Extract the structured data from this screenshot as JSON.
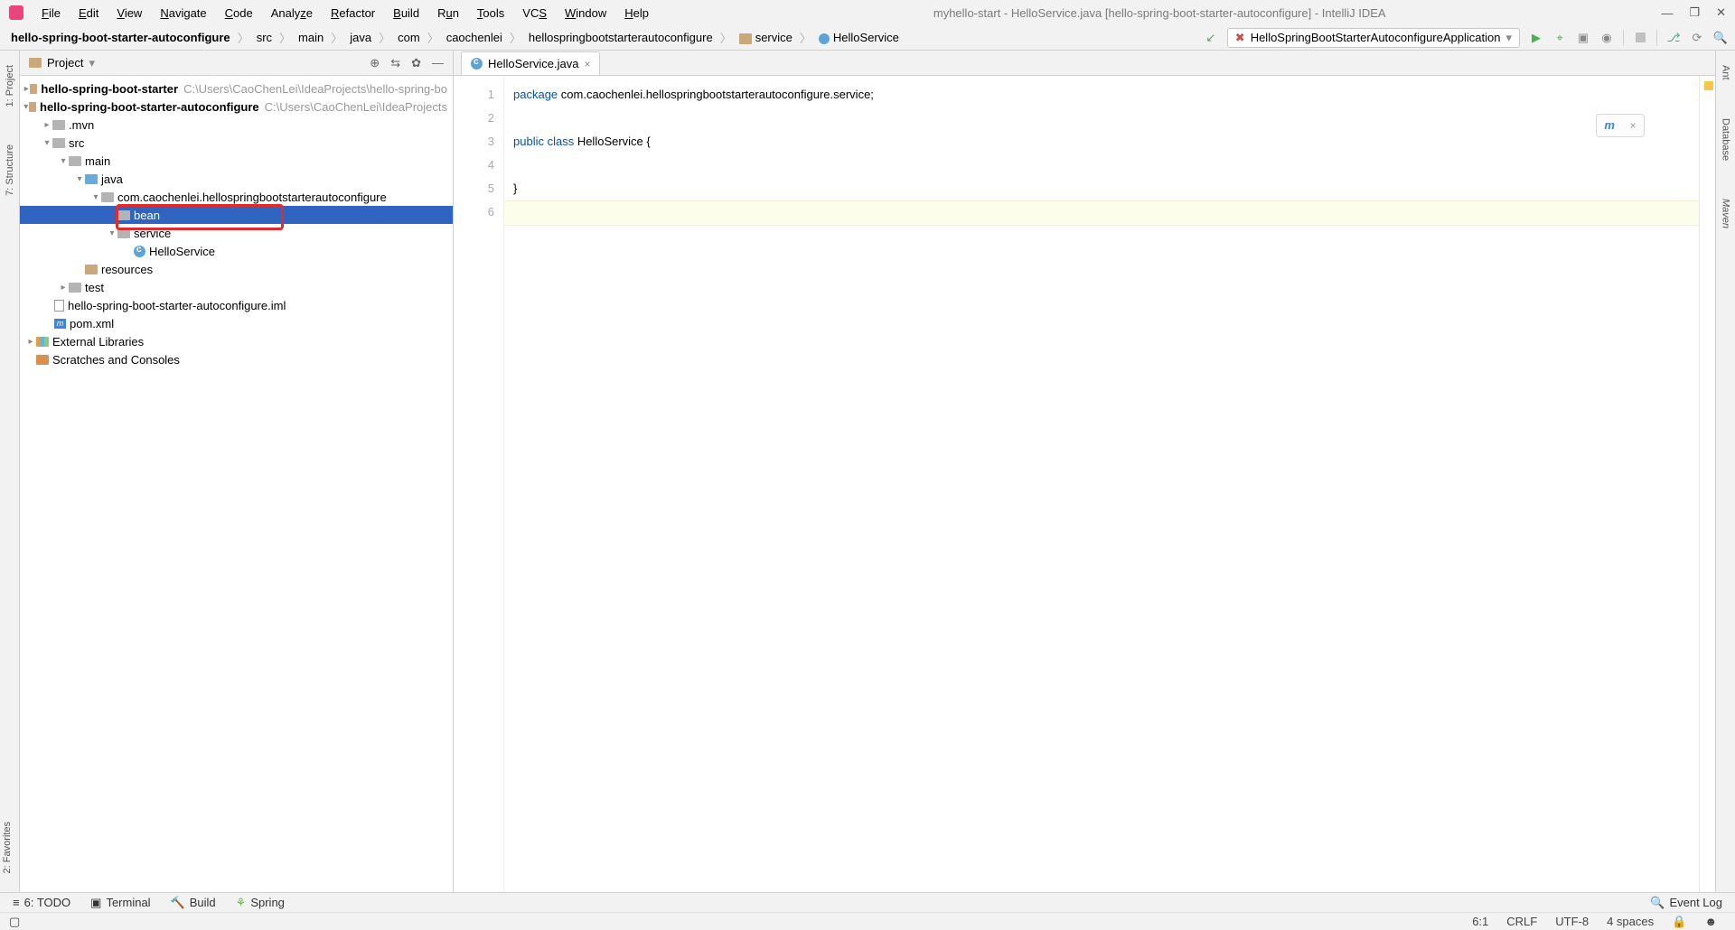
{
  "title": "myhello-start - HelloService.java [hello-spring-boot-starter-autoconfigure] - IntelliJ IDEA",
  "menu": [
    "File",
    "Edit",
    "View",
    "Navigate",
    "Code",
    "Analyze",
    "Refactor",
    "Build",
    "Run",
    "Tools",
    "VCS",
    "Window",
    "Help"
  ],
  "breadcrumbs": [
    "hello-spring-boot-starter-autoconfigure",
    "src",
    "main",
    "java",
    "com",
    "caochenlei",
    "hellospringbootstarterautoconfigure",
    "service",
    "HelloService"
  ],
  "run_config": "HelloSpringBootStarterAutoconfigureApplication",
  "project_panel_title": "Project",
  "left_tabs": [
    "1: Project",
    "7: Structure"
  ],
  "left_bottom_tab": "2: Favorites",
  "right_tabs": [
    "Ant",
    "Database",
    "Maven"
  ],
  "tree": {
    "module1": {
      "name": "hello-spring-boot-starter",
      "path": "C:\\Users\\CaoChenLei\\IdeaProjects\\hello-spring-bo"
    },
    "module2": {
      "name": "hello-spring-boot-starter-autoconfigure",
      "path": "C:\\Users\\CaoChenLei\\IdeaProjects"
    },
    "mvn": ".mvn",
    "src": "src",
    "main": "main",
    "java": "java",
    "pkg": "com.caochenlei.hellospringbootstarterautoconfigure",
    "bean": "bean",
    "service": "service",
    "helloservice": "HelloService",
    "resources": "resources",
    "test": "test",
    "iml": "hello-spring-boot-starter-autoconfigure.iml",
    "pom": "pom.xml",
    "ext": "External Libraries",
    "scratch": "Scratches and Consoles"
  },
  "editor_tab": "HelloService.java",
  "code": {
    "l1a": "package",
    "l1b": " com.caochenlei.hellospringbootstarterautoconfigure.service;",
    "l3a": "public",
    "l3b": " class",
    "l3c": " HelloService {",
    "l5": "}",
    "line_numbers": [
      "1",
      "2",
      "3",
      "4",
      "5",
      "6"
    ]
  },
  "toolwindows": [
    "6: TODO",
    "Terminal",
    "Build",
    "Spring"
  ],
  "event_log": "Event Log",
  "status": {
    "pos": "6:1",
    "linesep": "CRLF",
    "encoding": "UTF-8",
    "indent": "4 spaces"
  }
}
